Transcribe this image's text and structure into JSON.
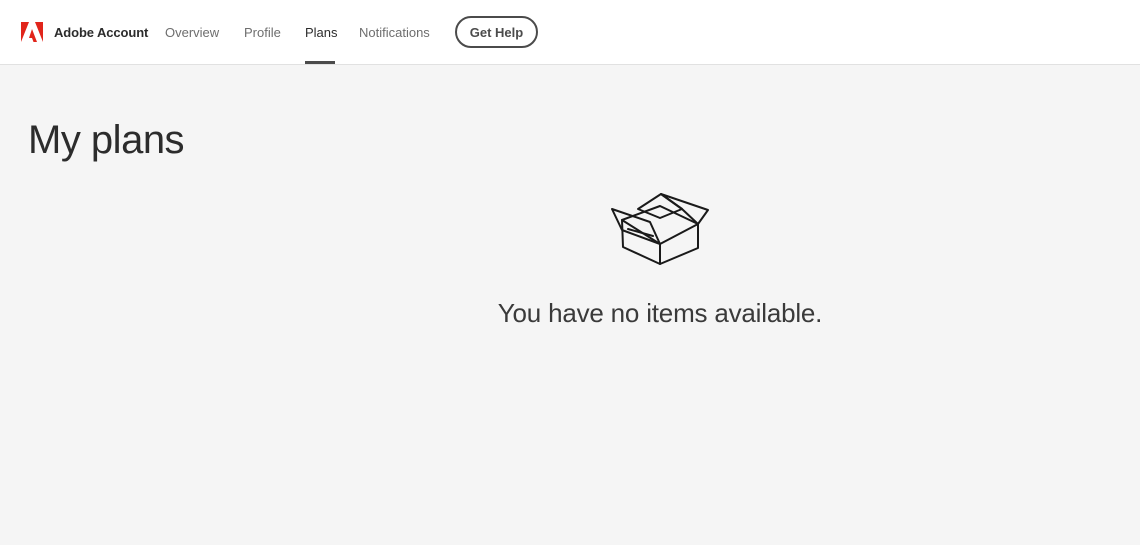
{
  "header": {
    "brand_name": "Adobe Account",
    "logo_icon": "adobe-logo-icon",
    "brand_color": "#e1251b",
    "nav": [
      {
        "label": "Overview",
        "active": false
      },
      {
        "label": "Profile",
        "active": false
      },
      {
        "label": "Plans",
        "active": true
      },
      {
        "label": "Notifications",
        "active": false
      }
    ],
    "help_button": "Get Help"
  },
  "main": {
    "title": "My plans",
    "empty_state": {
      "icon": "open-box-icon",
      "message": "You have no items available."
    }
  }
}
